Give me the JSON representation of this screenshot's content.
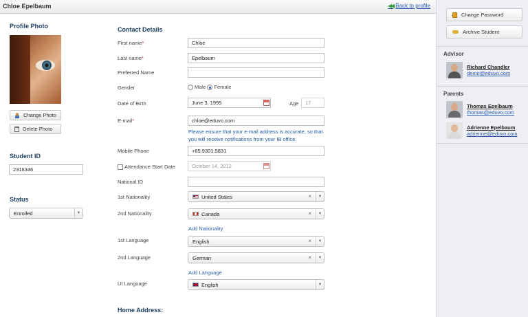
{
  "header": {
    "student_name": "Chloe Epelbaum",
    "back_label": "Back to profile"
  },
  "profile_photo": {
    "title": "Profile Photo",
    "change_label": "Change Photo",
    "delete_label": "Delete Photo"
  },
  "student_id": {
    "title": "Student ID",
    "value": "2316346"
  },
  "status": {
    "title": "Status",
    "value": "Enrolled"
  },
  "contact": {
    "title": "Contact Details",
    "first_name": {
      "label": "First name",
      "req": "*",
      "value": "Chloe"
    },
    "last_name": {
      "label": "Last name",
      "req": "*",
      "value": "Epelbaum"
    },
    "preferred_name": {
      "label": "Preferred Name",
      "value": ""
    },
    "gender": {
      "label": "Gender",
      "male": "Male",
      "female": "Female"
    },
    "dob": {
      "label": "Date of Birth",
      "value": "June 3, 1995",
      "age_label": "Age",
      "age_value": "17"
    },
    "email": {
      "label": "E-mail",
      "req": "*",
      "value": "chloe@eduvo.com",
      "note": "Please ensure that your e-mail address is accurate, so that you will receive notifications from your IB office."
    },
    "mobile": {
      "label": "Mobile Phone",
      "value": "+65.9301.5831"
    },
    "attendance": {
      "label": "Attendance Start Date",
      "value": "October 14, 2012"
    },
    "national_id": {
      "label": "National ID",
      "value": ""
    },
    "nat1": {
      "label": "1st Nationality",
      "value": "United States"
    },
    "nat2": {
      "label": "2nd Nationality",
      "value": "Canada"
    },
    "add_nationality": "Add Nationality",
    "lang1": {
      "label": "1st Language",
      "value": "English"
    },
    "lang2": {
      "label": "2nd Language",
      "value": "German"
    },
    "add_language": "Add Language",
    "ui_lang": {
      "label": "UI Language",
      "value": "English"
    },
    "home_address": "Home Address:"
  },
  "sidebar": {
    "change_password": "Change Password",
    "archive_student": "Archive Student",
    "advisor_title": "Advisor",
    "advisor": {
      "name": "Richard Chandler",
      "email": "demo@eduvo.com"
    },
    "parents_title": "Parents",
    "parents": [
      {
        "name": "Thomas Epelbaum",
        "email": "thomas@eduvo.com"
      },
      {
        "name": "Adrienne Epelbaum",
        "email": "adrienne@eduvo.com"
      }
    ]
  },
  "colors": {
    "link": "#2a5db0",
    "section_title": "#1f3f66",
    "sidebar_bg": "#edeff2"
  }
}
